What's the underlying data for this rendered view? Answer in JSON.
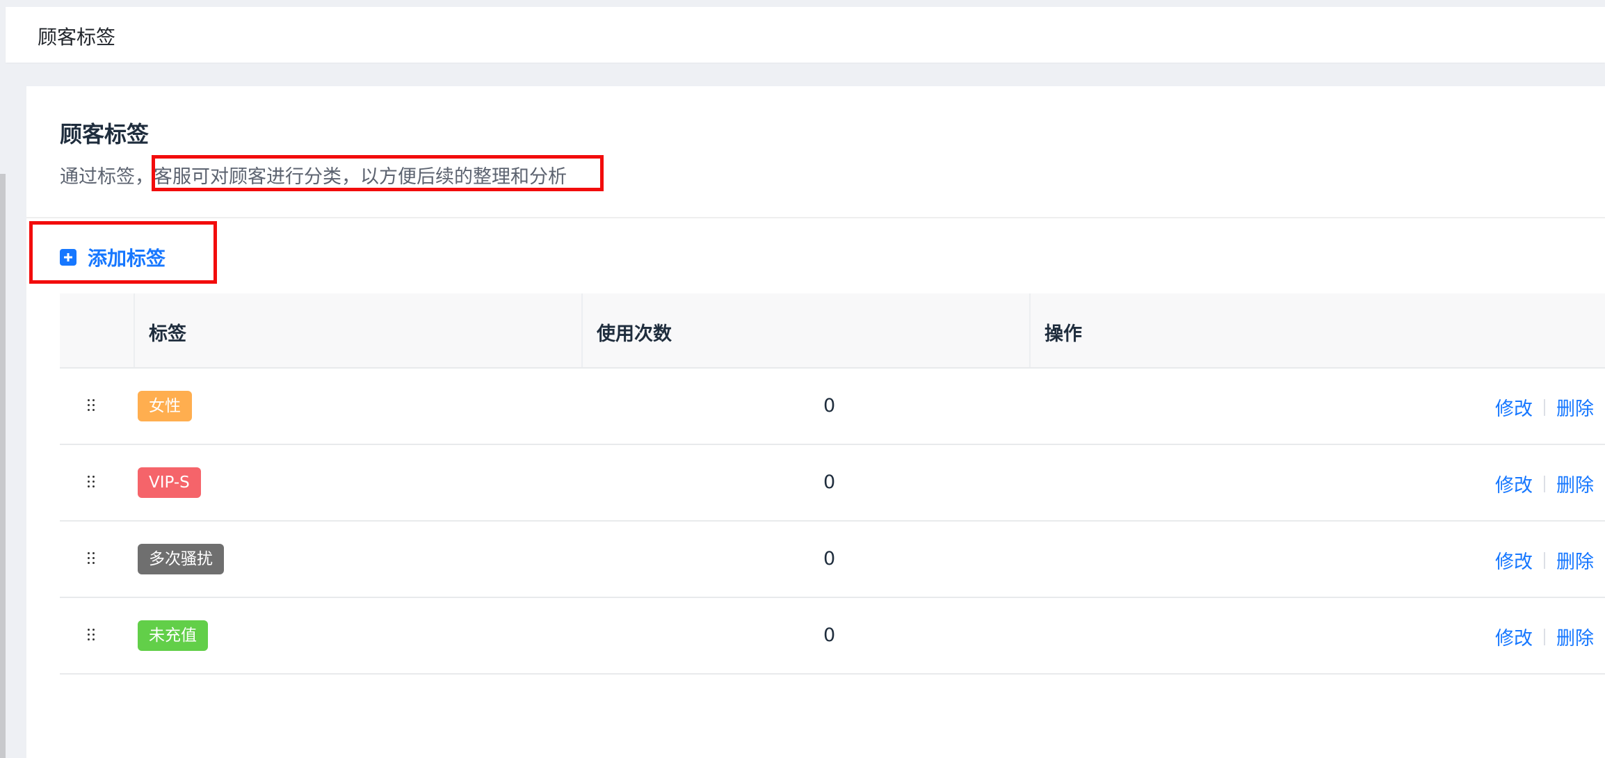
{
  "topbar": {
    "title": "顾客标签"
  },
  "page": {
    "title": "顾客标签",
    "description": "通过标签，客服可对顾客进行分类，以方便后续的整理和分析"
  },
  "add_button": {
    "label": "添加标签",
    "icon": "plus-square-icon"
  },
  "table": {
    "columns": [
      "标签",
      "使用次数",
      "操作"
    ],
    "rows": [
      {
        "tag": "女性",
        "tag_color": "#ffae4f",
        "count": "0",
        "edit": "修改",
        "delete": "删除"
      },
      {
        "tag": "VIP-S",
        "tag_color": "#f5646a",
        "count": "0",
        "edit": "修改",
        "delete": "删除"
      },
      {
        "tag": "多次骚扰",
        "tag_color": "#6f6f6f",
        "count": "0",
        "edit": "修改",
        "delete": "删除"
      },
      {
        "tag": "未充值",
        "tag_color": "#62cf49",
        "count": "0",
        "edit": "修改",
        "delete": "删除"
      }
    ]
  },
  "colors": {
    "accent": "#1677ff",
    "highlight": "#f20c0c"
  }
}
